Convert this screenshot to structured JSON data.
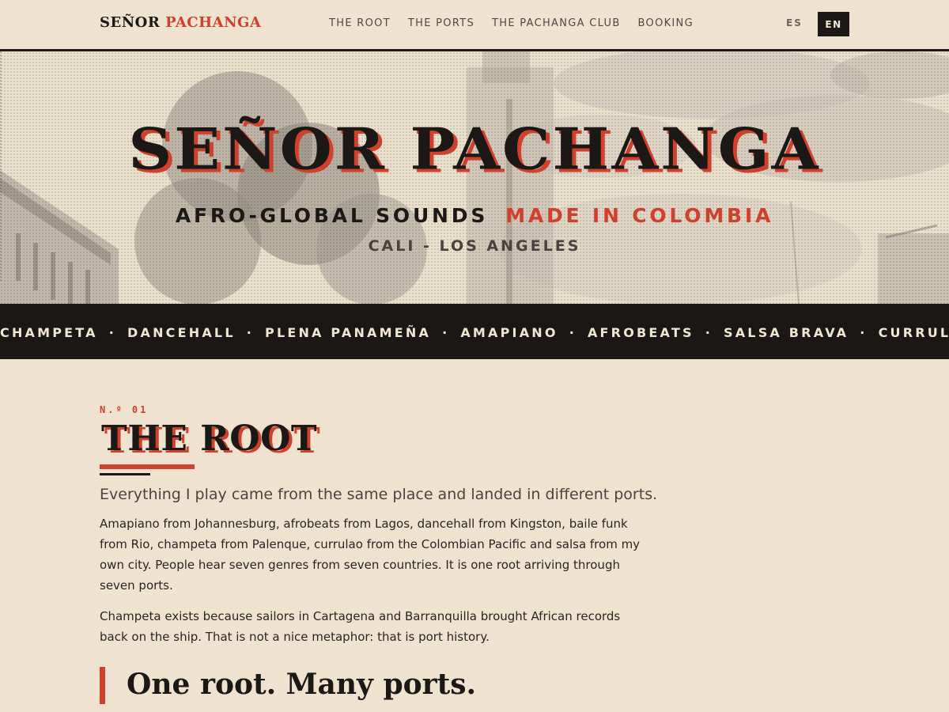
{
  "nav": {
    "logo_part1": "SEÑOR",
    "logo_part2": "PACHANGA",
    "links": [
      "THE ROOT",
      "THE PORTS",
      "THE PACHANGA CLUB",
      "BOOKING"
    ],
    "lang": [
      "ES",
      "EN"
    ],
    "active_lang": "EN"
  },
  "hero": {
    "title": "SEÑOR PACHANGA",
    "subtitle_part1": "AFRO-GLOBAL SOUNDS",
    "subtitle_part2": "MADE IN COLOMBIA",
    "cities": "CALI - LOS ANGELES"
  },
  "ticker": {
    "genres": [
      "CHAMPETA",
      "DANCEHALL",
      "PLENA PANAMEÑA",
      "AMAPIANO",
      "AFROBEATS",
      "SALSA BRAVA",
      "CURRULAO"
    ],
    "separator": "·"
  },
  "section": {
    "kicker": "N.º 01",
    "title": "THE ROOT",
    "lead": "Everything I play came from the same place and landed in different ports.",
    "para1": "Amapiano from Johannesburg, afrobeats from Lagos, dancehall from Kingston, baile funk from Rio, champeta from Palenque, currulao from the Colombian Pacific and salsa from my own city. People hear seven genres from seven countries. It is one root arriving through seven ports.",
    "para2": "Champeta exists because sailors in Cartagena and Barranquilla brought African records back on the ship. That is not a nice metaphor: that is port history.",
    "pullquote": "One root. Many ports."
  },
  "colors": {
    "background": "#efe3cf",
    "ink": "#1c1816",
    "accent": "#d0402c",
    "ticker_bg": "#1b1715"
  }
}
